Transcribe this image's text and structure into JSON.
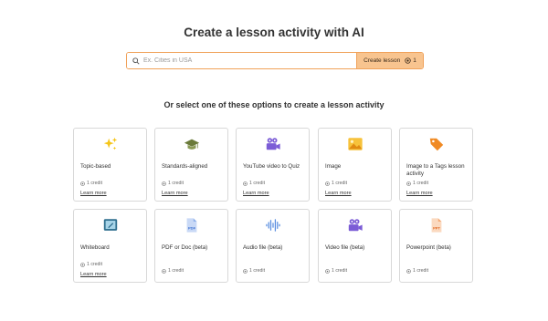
{
  "header": {
    "title": "Create a lesson activity with AI"
  },
  "search": {
    "placeholder": "Ex. Cities in USA",
    "value": ""
  },
  "create_button": {
    "label": "Create lesson",
    "cost": "1"
  },
  "options_heading": "Or select one of these options to create a lesson activity",
  "cards": [
    {
      "title": "Topic-based",
      "credit": "1 credit",
      "learn_more": "Learn more",
      "icon": "sparkles-icon"
    },
    {
      "title": "Standards-aligned",
      "credit": "1 credit",
      "learn_more": "Learn more",
      "icon": "graduation-cap-icon"
    },
    {
      "title": "YouTube video to Quiz",
      "credit": "1 credit",
      "learn_more": "Learn more",
      "icon": "video-camera-icon"
    },
    {
      "title": "Image",
      "credit": "1 credit",
      "learn_more": "Learn more",
      "icon": "image-icon"
    },
    {
      "title": "Image to a Tags lesson activity",
      "credit": "1 credit",
      "learn_more": "Learn more",
      "icon": "tag-icon"
    },
    {
      "title": "Whiteboard",
      "credit": "1 credit",
      "learn_more": "Learn more",
      "icon": "whiteboard-icon"
    },
    {
      "title": "PDF or Doc (beta)",
      "credit": "1 credit",
      "icon": "pdf-file-icon"
    },
    {
      "title": "Audio file (beta)",
      "credit": "1 credit",
      "icon": "audio-wave-icon"
    },
    {
      "title": "Video file (beta)",
      "credit": "1 credit",
      "icon": "video-camera-icon"
    },
    {
      "title": "Powerpoint (beta)",
      "credit": "1 credit",
      "icon": "ppt-file-icon"
    }
  ],
  "colors": {
    "accent": "#f8c48f",
    "accent_border": "#f0a25a",
    "icon_purple": "#7b5cd6",
    "icon_orange": "#f08a24"
  }
}
